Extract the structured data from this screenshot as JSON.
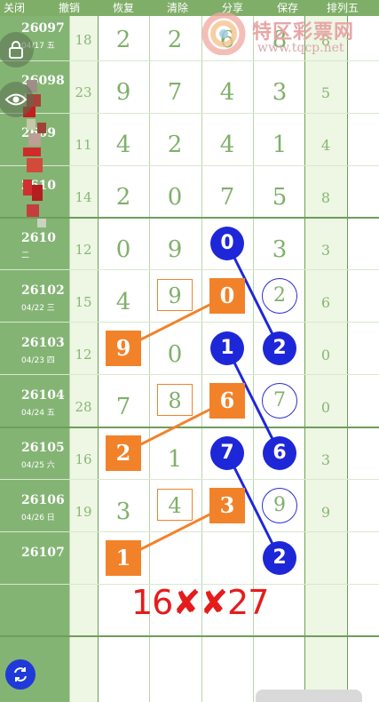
{
  "toolbar": {
    "close": "关闭",
    "undo": "撤销",
    "redo": "恢复",
    "clear": "清除",
    "share": "分享",
    "save": "保存",
    "mode": "排列五"
  },
  "watermark": {
    "title": "特区彩票网",
    "url": "www.tqcp.net"
  },
  "rows": [
    {
      "id": "26097",
      "sub": "04/17 五",
      "sum": "18",
      "d1": "2",
      "d2": "2",
      "d3": "6",
      "d4": "8",
      "last": "8"
    },
    {
      "id": "26098",
      "sub": "六",
      "sum": "23",
      "d1": "9",
      "d2": "7",
      "d3": "4",
      "d4": "3",
      "last": "5"
    },
    {
      "id": "2609",
      "sub": "",
      "sum": "11",
      "d1": "4",
      "d2": "2",
      "d3": "4",
      "d4": "1",
      "last": "4"
    },
    {
      "id": "2610",
      "sub": "",
      "sum": "14",
      "d1": "2",
      "d2": "0",
      "d3": "7",
      "d4": "5",
      "last": "8"
    },
    {
      "id": "2610",
      "sub": "二",
      "sum": "12",
      "d1": "0",
      "d2": "9",
      "d3": "0",
      "d4": "3",
      "last": "3"
    },
    {
      "id": "26102",
      "sub": "04/22 三",
      "sum": "15",
      "d1": "4",
      "d2": "9",
      "d3": "0",
      "d4": "2",
      "last": "6"
    },
    {
      "id": "26103",
      "sub": "04/23 四",
      "sum": "12",
      "d1": "9",
      "d2": "0",
      "d3": "1",
      "d4": "2",
      "last": "0"
    },
    {
      "id": "26104",
      "sub": "04/24 五",
      "sum": "28",
      "d1": "7",
      "d2": "8",
      "d3": "6",
      "d4": "7",
      "last": "0"
    },
    {
      "id": "26105",
      "sub": "04/25 六",
      "sum": "16",
      "d1": "2",
      "d2": "1",
      "d3": "7",
      "d4": "6",
      "last": "3"
    },
    {
      "id": "26106",
      "sub": "04/26 日",
      "sum": "19",
      "d1": "3",
      "d2": "4",
      "d3": "3",
      "d4": "9",
      "last": "9"
    },
    {
      "id": "26107",
      "sub": "",
      "sum": "",
      "d1": "1",
      "d2": "",
      "d3": "",
      "d4": "2",
      "last": ""
    }
  ],
  "result": "16✘✘27",
  "colors": {
    "green": "#84b474",
    "orange": "#f2822a",
    "blue": "#1e27d8",
    "red": "#e41c1c"
  },
  "icons": [
    "lock-icon",
    "eye-icon",
    "refresh-icon"
  ]
}
